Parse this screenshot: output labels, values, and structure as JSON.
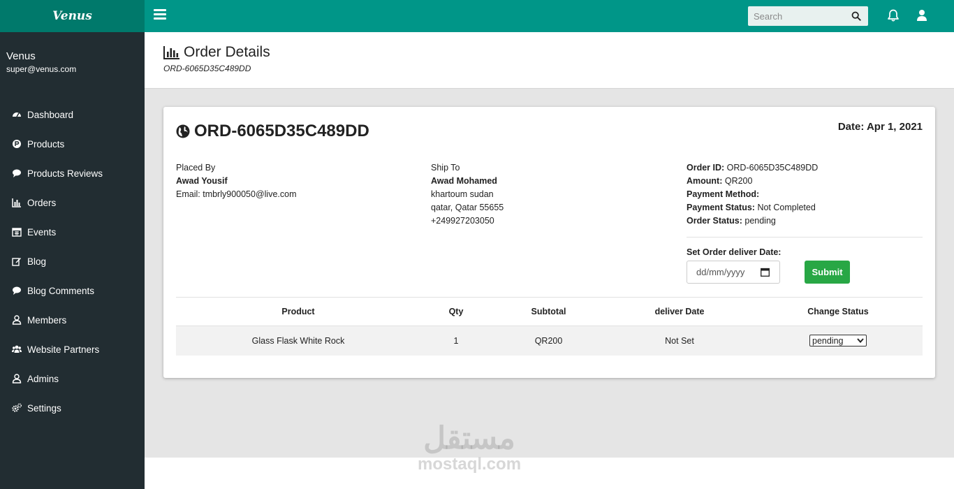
{
  "brand": "Venus",
  "search": {
    "placeholder": "Search"
  },
  "profile": {
    "name": "Venus",
    "email": "super@venus.com"
  },
  "sidebar": {
    "items": [
      {
        "label": "Dashboard",
        "icon": "dashboard-icon"
      },
      {
        "label": "Products",
        "icon": "product-hunt-icon"
      },
      {
        "label": "Products Reviews",
        "icon": "comment-icon"
      },
      {
        "label": "Orders",
        "icon": "bar-chart-icon"
      },
      {
        "label": "Events",
        "icon": "calendar-icon"
      },
      {
        "label": "Blog",
        "icon": "edit-icon"
      },
      {
        "label": "Blog Comments",
        "icon": "comment-icon"
      },
      {
        "label": "Members",
        "icon": "user-icon"
      },
      {
        "label": "Website Partners",
        "icon": "users-icon"
      },
      {
        "label": "Admins",
        "icon": "user-icon"
      },
      {
        "label": "Settings",
        "icon": "cogs-icon"
      }
    ]
  },
  "header": {
    "title": "Order Details",
    "subtitle": "ORD-6065D35C489DD"
  },
  "order": {
    "number": "ORD-6065D35C489DD",
    "date_label": "Date:",
    "date": "Apr 1, 2021",
    "placed_by": {
      "label": "Placed By",
      "name": "Awad Yousif",
      "email_label": "Email:",
      "email": "tmbrly900050@live.com"
    },
    "ship_to": {
      "label": "Ship To",
      "name": "Awad Mohamed",
      "line1": "khartoum sudan",
      "line2": "qatar, Qatar 55655",
      "phone": "+249927203050"
    },
    "info": {
      "order_id_label": "Order ID:",
      "order_id": "ORD-6065D35C489DD",
      "amount_label": "Amount:",
      "amount": "QR200",
      "payment_method_label": "Payment Method:",
      "payment_method": "",
      "payment_status_label": "Payment Status:",
      "payment_status": "Not Completed",
      "order_status_label": "Order Status:",
      "order_status": "pending"
    },
    "deliver": {
      "label": "Set Order deliver Date:",
      "placeholder": "dd/mm/yyyy",
      "submit_label": "Submit"
    }
  },
  "table": {
    "headers": [
      "Product",
      "Qty",
      "Subtotal",
      "deliver Date",
      "Change Status"
    ],
    "rows": [
      {
        "product": "Glass Flask White Rock",
        "qty": "1",
        "subtotal": "QR200",
        "deliver_date": "Not Set",
        "status": "pending"
      }
    ]
  },
  "watermark": {
    "arabic": "مستقل",
    "latin": "mostaql.com"
  },
  "colors": {
    "topbar": "#009688",
    "brand_bg": "#00796b",
    "sidebar": "#222d32",
    "submit": "#28a745"
  }
}
